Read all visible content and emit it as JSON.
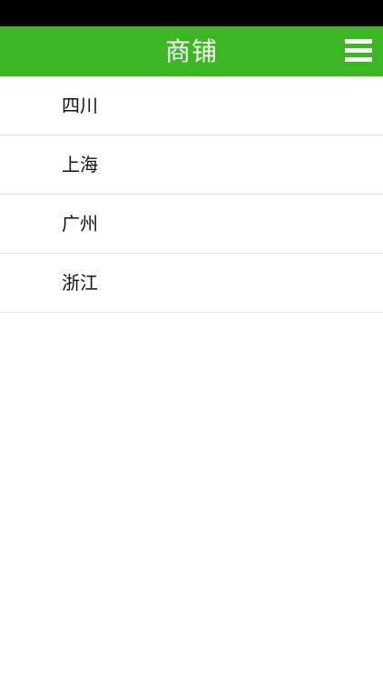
{
  "header": {
    "title": "商铺",
    "menu_icon": "hamburger-menu-icon",
    "background_color": "#3db624"
  },
  "status_bar": {
    "background_color": "#000000"
  },
  "list": {
    "items": [
      {
        "label": "四川"
      },
      {
        "label": "上海"
      },
      {
        "label": "广州"
      },
      {
        "label": "浙江"
      }
    ]
  }
}
